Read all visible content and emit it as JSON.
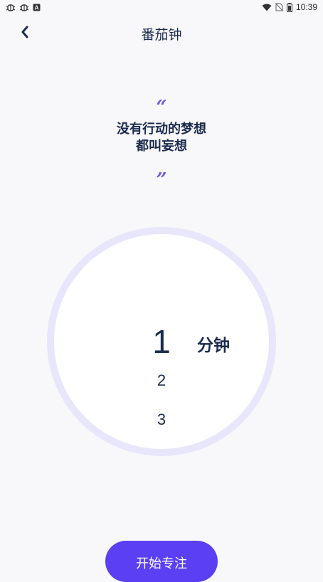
{
  "status_bar": {
    "time": "10:39",
    "left_icons": [
      "bug-icon",
      "bug-icon",
      "notification-a-icon"
    ],
    "right_icons": [
      "wifi-icon",
      "no-sim-icon",
      "battery-icon"
    ],
    "notification_letter": "A"
  },
  "header": {
    "title": "番茄钟",
    "back_icon": "chevron-left-icon"
  },
  "quote": {
    "open_mark": "“",
    "line1": "没有行动的梦想",
    "line2": "都叫妄想",
    "close_mark": "”"
  },
  "timer": {
    "options": [
      "1",
      "2",
      "3"
    ],
    "selected": "1",
    "unit": "分钟"
  },
  "actions": {
    "start_label": "开始专注"
  },
  "colors": {
    "accent": "#5b3ff3",
    "quote_mark": "#6c5ce7",
    "ring": "#e7e6fb",
    "text_dark": "#1c2a4d",
    "background": "#f8f8fa"
  }
}
